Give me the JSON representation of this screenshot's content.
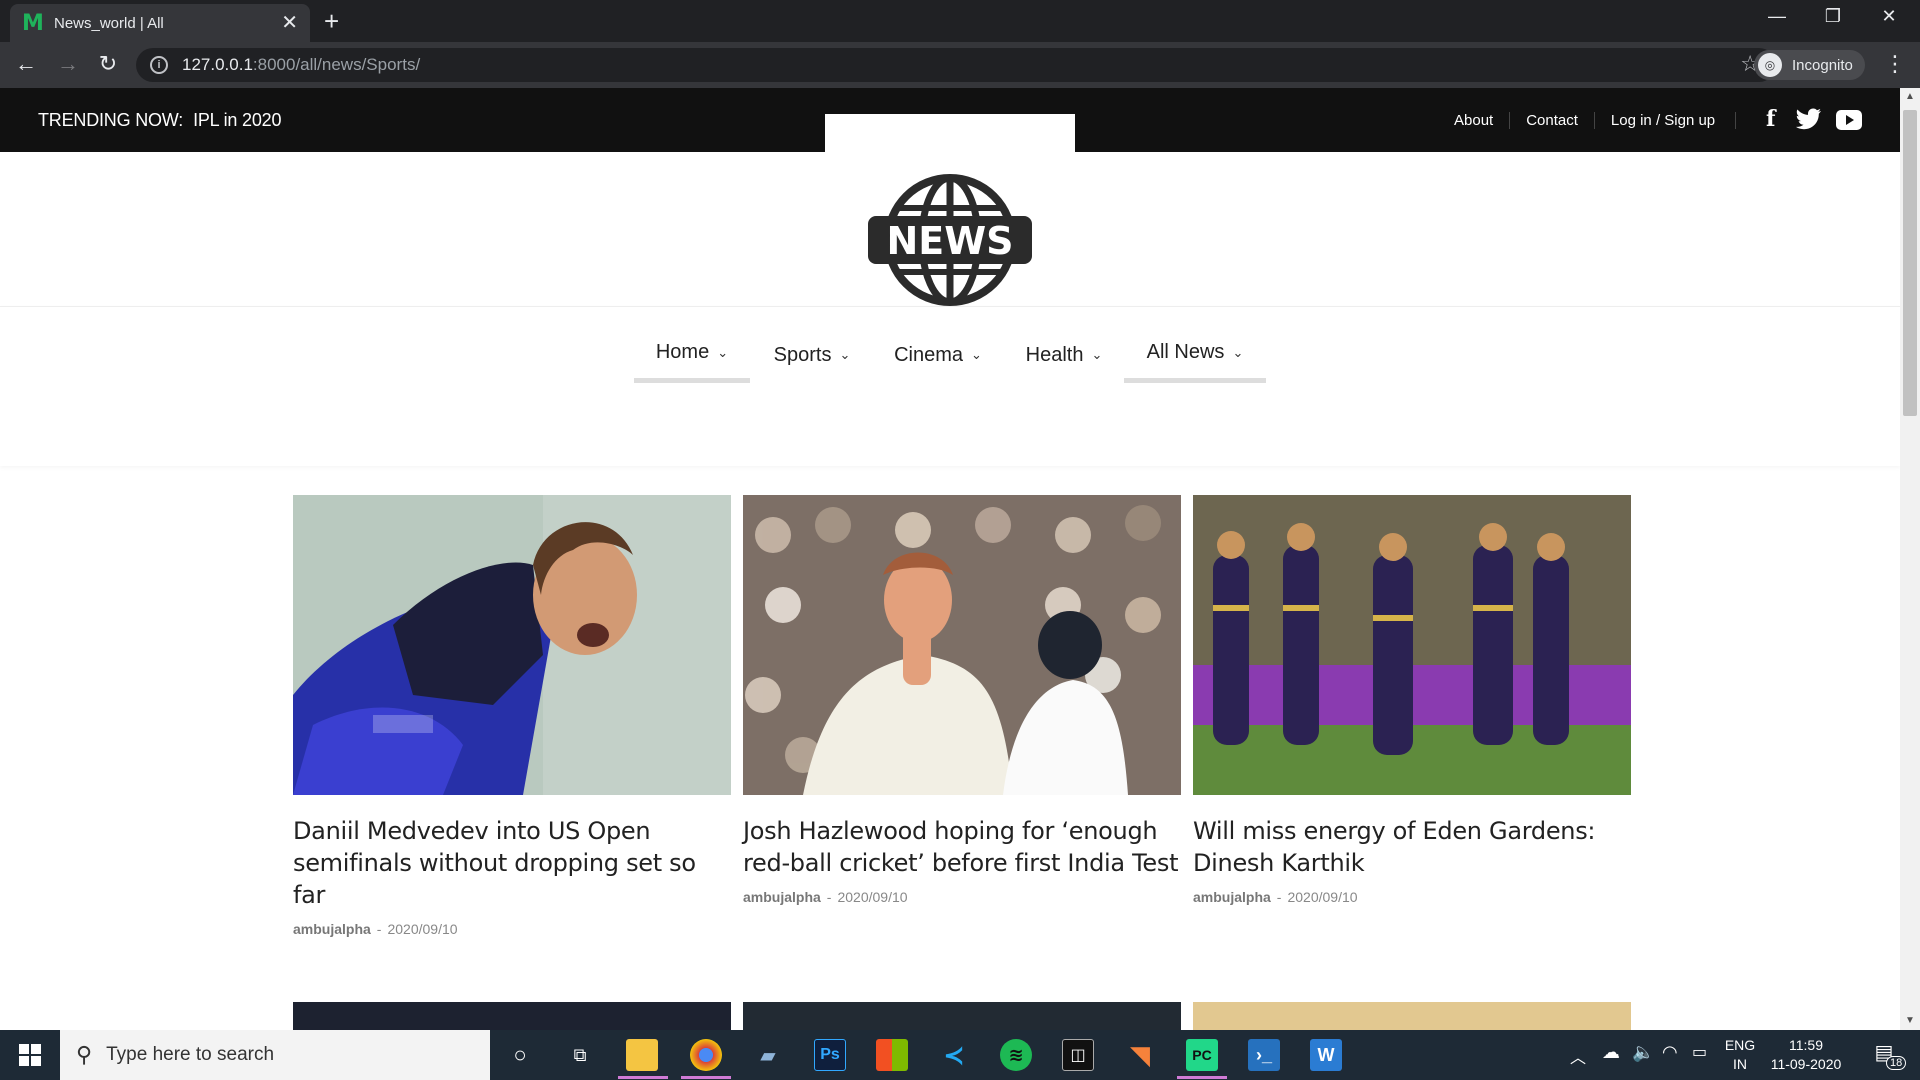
{
  "browser": {
    "tab_title": "News_world | All",
    "tab_favicon": "M",
    "url_host": "127.0.0.1",
    "url_rest": ":8000/all/news/Sports/",
    "profile_label": "Incognito"
  },
  "site": {
    "trending_label": "TRENDING NOW:",
    "trending_text": "IPL in 2020",
    "top_links": [
      "About",
      "Contact",
      "Log in / Sign up"
    ],
    "logo_text": "NEWS",
    "social_icons": [
      "facebook-icon",
      "twitter-icon",
      "youtube-icon"
    ],
    "nav": [
      {
        "label": "Home",
        "active": true
      },
      {
        "label": "Sports",
        "active": false
      },
      {
        "label": "Cinema",
        "active": false
      },
      {
        "label": "Health",
        "active": false
      },
      {
        "label": "All News",
        "active": true
      }
    ]
  },
  "articles": [
    {
      "title": "Daniil Medvedev into US Open semifinals without dropping set so far",
      "author": "ambujalpha",
      "date": "2020/09/10"
    },
    {
      "title": "Josh Hazlewood hoping for ‘enough red-ball cricket’ before first India Test",
      "author": "ambujalpha",
      "date": "2020/09/10"
    },
    {
      "title": "Will miss energy of Eden Gardens: Dinesh Karthik",
      "author": "ambujalpha",
      "date": "2020/09/10"
    }
  ],
  "meta_separator": "-",
  "taskbar": {
    "search_placeholder": "Type here to search",
    "lang_top": "ENG",
    "lang_bottom": "IN",
    "time": "11:59",
    "date": "11-09-2020",
    "notification_count": "18"
  }
}
